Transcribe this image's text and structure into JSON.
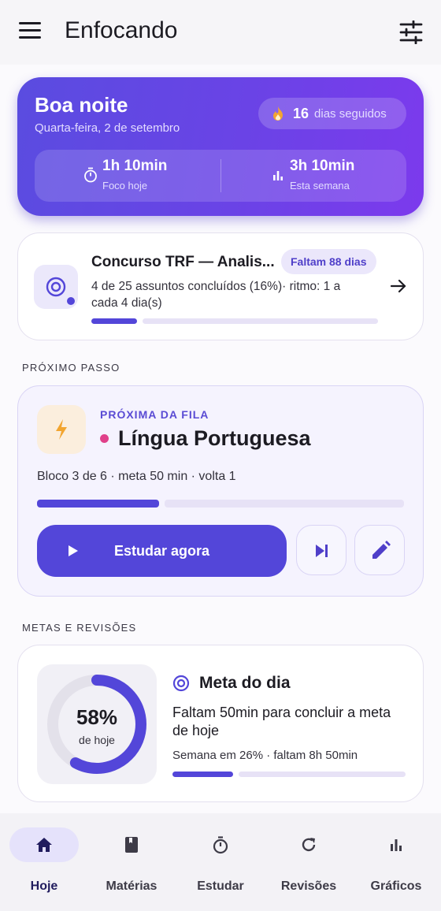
{
  "app": {
    "title": "Enfocando"
  },
  "hero": {
    "greeting": "Boa noite",
    "date": "Quarta-feira, 2 de setembro",
    "streak_count": "16",
    "streak_label": "dias seguidos",
    "stats": [
      {
        "value": "1h 10min",
        "label": "Foco hoje",
        "icon": "timer-icon"
      },
      {
        "value": "3h 10min",
        "label": "Esta semana",
        "icon": "bar-chart-icon"
      }
    ]
  },
  "goal_card": {
    "title": "Concurso TRF — Analis...",
    "badge": "Faltam 88 dias",
    "description": "4 de 25 assuntos concluídos (16%)· ritmo: 1 a cada 4 dia(s)",
    "progress": 0.16
  },
  "next_step": {
    "section_label": "PRÓXIMO PASSO",
    "kicker": "PRÓXIMA DA FILA",
    "subject": "Língua Portuguesa",
    "subject_color": "#e0408a",
    "meta": "Bloco 3 de 6 · meta 50 min · volta 1",
    "progress": 0.333,
    "cta_label": "Estudar agora"
  },
  "goals_section": {
    "section_label": "METAS E REVISÕES",
    "ring_percent": "58%",
    "ring_value": 0.58,
    "ring_sub": "de hoje",
    "title": "Meta do dia",
    "description": "Faltam 50min para concluir a meta de hoje",
    "week_text": "Semana em 26% · faltam 8h 50min",
    "week_progress": 0.26
  },
  "nav": {
    "items": [
      {
        "label": "Hoje",
        "icon": "home-icon",
        "active": true
      },
      {
        "label": "Matérias",
        "icon": "book-icon",
        "active": false
      },
      {
        "label": "Estudar",
        "icon": "stopwatch-icon",
        "active": false
      },
      {
        "label": "Revisões",
        "icon": "refresh-icon",
        "active": false
      },
      {
        "label": "Gráficos",
        "icon": "bar-chart-icon",
        "active": false
      }
    ]
  },
  "colors": {
    "primary": "#5346d9",
    "hero_start": "#5a4ce0",
    "hero_end": "#7c3aed",
    "accent_bolt": "#f2a530"
  }
}
